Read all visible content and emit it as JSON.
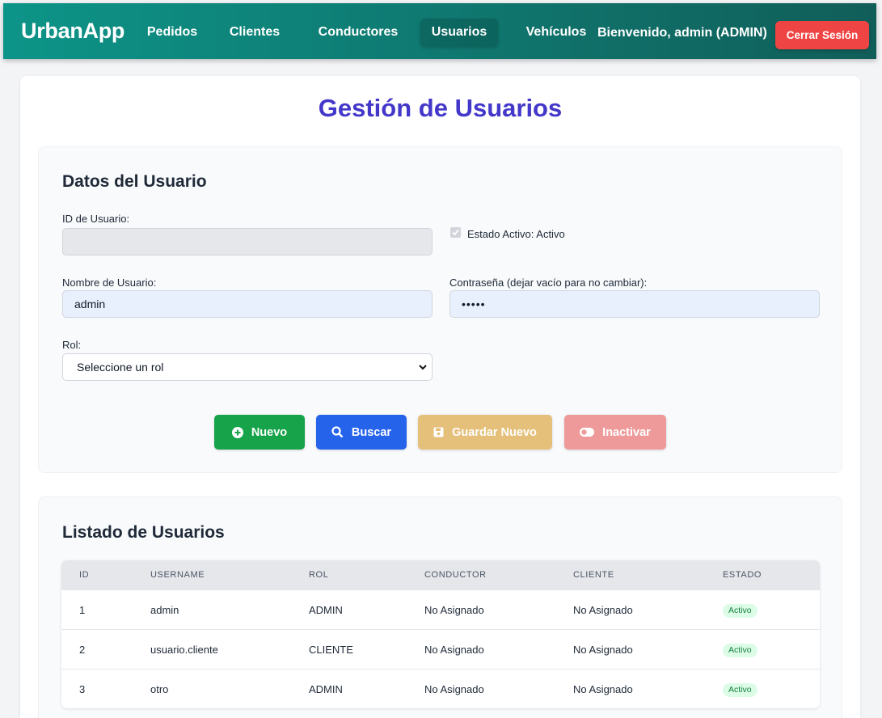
{
  "nav": {
    "brand": "UrbanApp",
    "links": [
      {
        "label": "Pedidos"
      },
      {
        "label": "Clientes"
      },
      {
        "label": "Conductores"
      },
      {
        "label": "Usuarios",
        "active": true
      },
      {
        "label": "Vehículos"
      }
    ],
    "welcome": "Bienvenido, admin (ADMIN)",
    "logout": "Cerrar Sesión"
  },
  "page": {
    "title": "Gestión de Usuarios"
  },
  "form": {
    "title": "Datos del Usuario",
    "id_label": "ID de Usuario:",
    "id_value": "",
    "active_label": "Estado Activo: Activo",
    "active_checked": true,
    "username_label": "Nombre de Usuario:",
    "username_value": "admin",
    "password_label": "Contraseña (dejar vacío para no cambiar):",
    "password_value": "•••••",
    "role_label": "Rol:",
    "role_selected": "Seleccione un rol",
    "buttons": {
      "new": "Nuevo",
      "search": "Buscar",
      "save": "Guardar Nuevo",
      "inactivate": "Inactivar"
    }
  },
  "list": {
    "title": "Listado de Usuarios",
    "columns": [
      "ID",
      "USERNAME",
      "ROL",
      "CONDUCTOR",
      "CLIENTE",
      "ESTADO"
    ],
    "rows": [
      {
        "id": "1",
        "username": "admin",
        "rol": "ADMIN",
        "conductor": "No Asignado",
        "cliente": "No Asignado",
        "estado": "Activo"
      },
      {
        "id": "2",
        "username": "usuario.cliente",
        "rol": "CLIENTE",
        "conductor": "No Asignado",
        "cliente": "No Asignado",
        "estado": "Activo"
      },
      {
        "id": "3",
        "username": "otro",
        "rol": "ADMIN",
        "conductor": "No Asignado",
        "cliente": "No Asignado",
        "estado": "Activo"
      }
    ]
  },
  "colors": {
    "nav_start": "#0d9488",
    "nav_end": "#115e59",
    "title": "#4338ca",
    "logout": "#ef4444",
    "btn_new": "#16a34a",
    "btn_search": "#2563eb",
    "btn_save": "#e5c07b",
    "btn_inactivate": "#ef9a9a",
    "badge_text": "#15803d",
    "badge_bg": "#dcfce7"
  }
}
